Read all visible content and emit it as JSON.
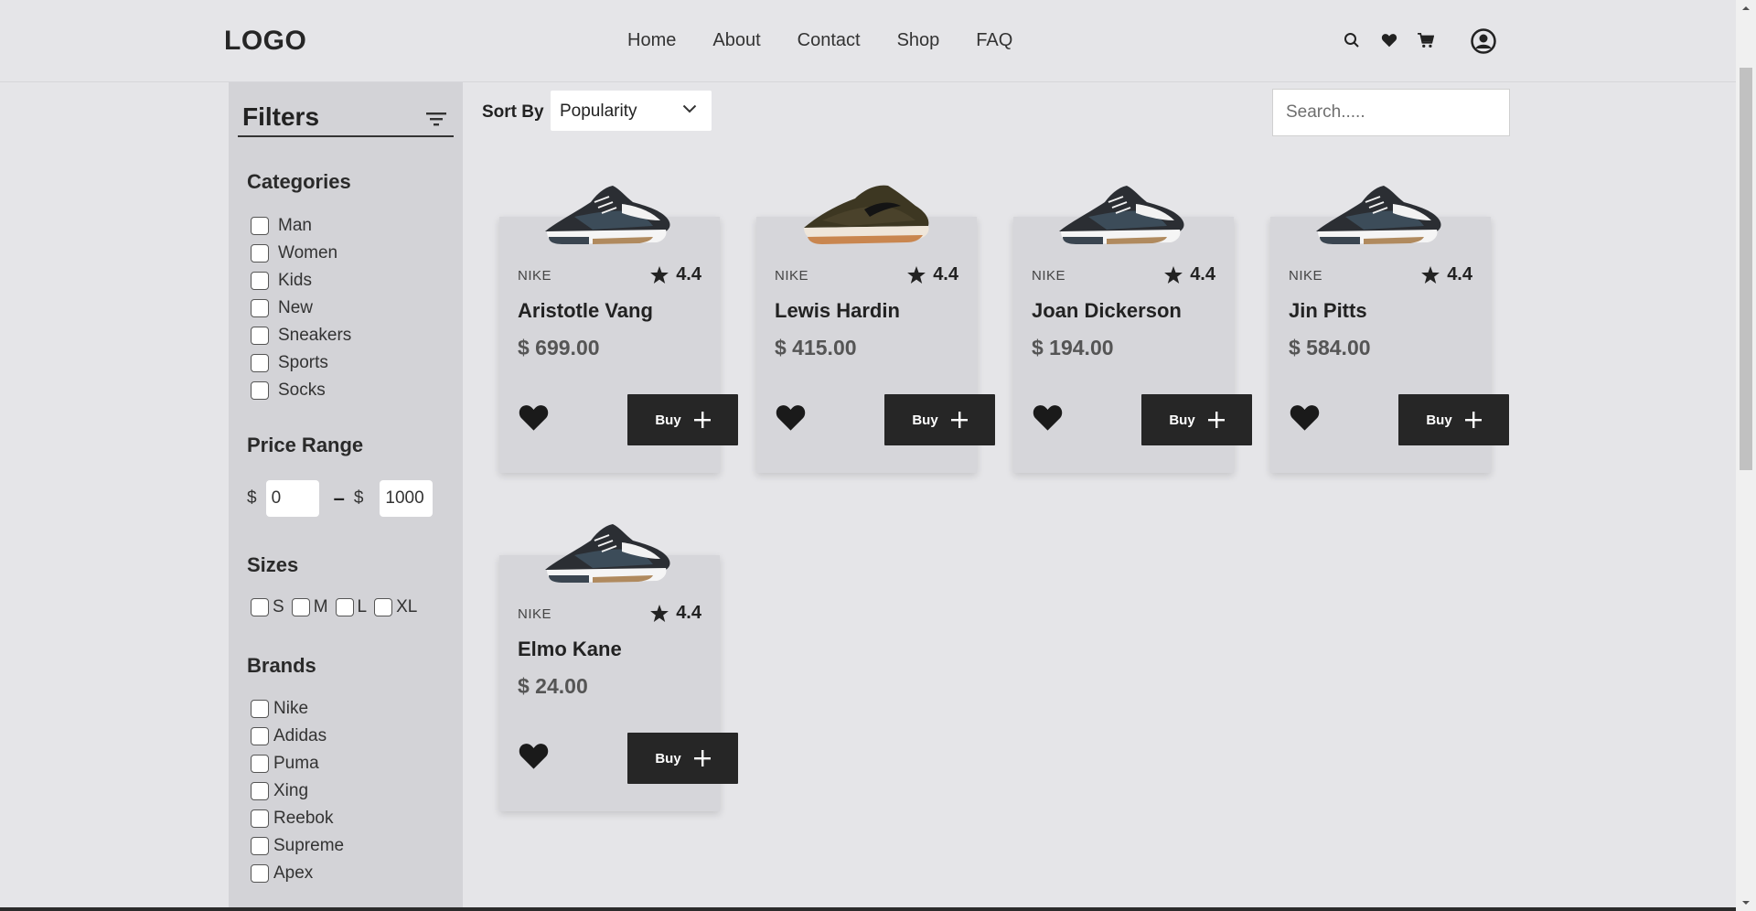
{
  "header": {
    "logo": "LOGO",
    "nav": [
      "Home",
      "About",
      "Contact",
      "Shop",
      "FAQ"
    ],
    "icons": [
      "search-icon",
      "heart-icon",
      "cart-icon",
      "user-icon"
    ]
  },
  "sidebar": {
    "title": "Filters",
    "categories_title": "Categories",
    "categories": [
      "Man",
      "Women",
      "Kids",
      "New",
      "Sneakers",
      "Sports",
      "Socks"
    ],
    "price_title": "Price Range",
    "price_currency": "$",
    "price_min": "0",
    "price_max": "1000",
    "sizes_title": "Sizes",
    "sizes": [
      "S",
      "M",
      "L",
      "XL"
    ],
    "brands_title": "Brands",
    "brands": [
      "Nike",
      "Adidas",
      "Puma",
      "Xing",
      "Reebok",
      "Supreme",
      "Apex"
    ]
  },
  "toolbar": {
    "sort_label": "Sort By",
    "sort_value": "Popularity",
    "search_placeholder": "Search....."
  },
  "products": [
    {
      "brand": "NIKE",
      "rating": "4.4",
      "name": "Aristotle Vang",
      "price": "$ 699.00",
      "buy": "Buy",
      "shoe": "black"
    },
    {
      "brand": "NIKE",
      "rating": "4.4",
      "name": "Lewis Hardin",
      "price": "$ 415.00",
      "buy": "Buy",
      "shoe": "brown"
    },
    {
      "brand": "NIKE",
      "rating": "4.4",
      "name": "Joan Dickerson",
      "price": "$ 194.00",
      "buy": "Buy",
      "shoe": "black"
    },
    {
      "brand": "NIKE",
      "rating": "4.4",
      "name": "Jin Pitts",
      "price": "$ 584.00",
      "buy": "Buy",
      "shoe": "black"
    },
    {
      "brand": "NIKE",
      "rating": "4.4",
      "name": "Elmo Kane",
      "price": "$ 24.00",
      "buy": "Buy",
      "shoe": "black"
    }
  ],
  "colors": {
    "background": "#e5e5e8",
    "sidebar": "#d3d3d7",
    "card": "#d6d6da",
    "button": "#262626"
  }
}
